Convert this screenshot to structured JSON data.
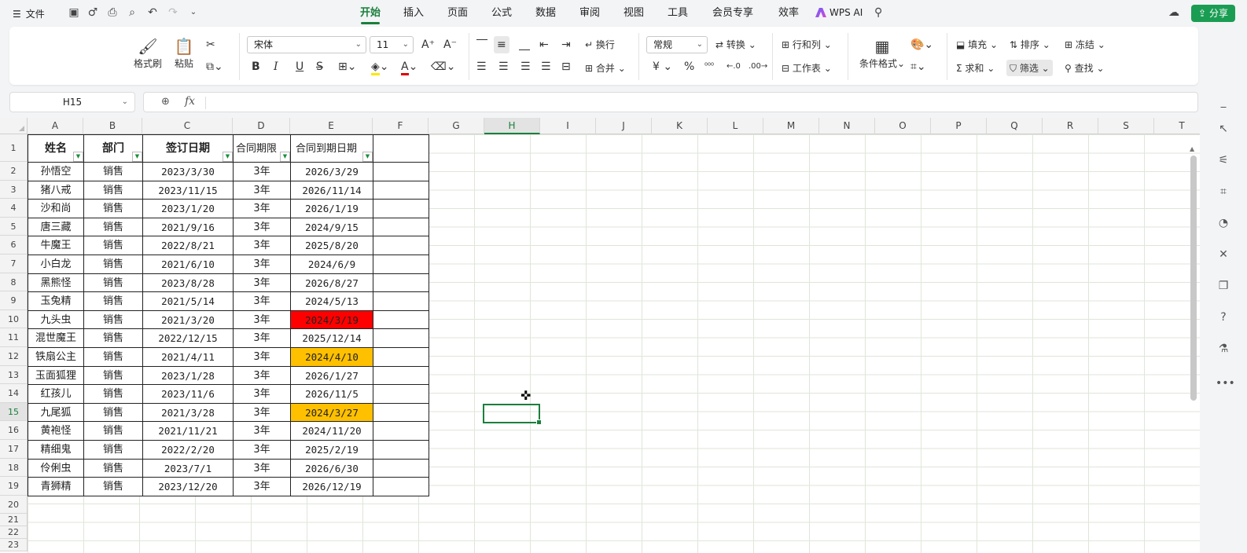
{
  "menubar": {
    "file_label": "文件",
    "tabs": [
      "开始",
      "插入",
      "页面",
      "公式",
      "数据",
      "审阅",
      "视图",
      "工具",
      "会员专享",
      "效率"
    ],
    "active_tab": "开始",
    "wps_ai": "WPS AI",
    "share": "分享"
  },
  "ribbon": {
    "format_painter": "格式刷",
    "paste": "粘贴",
    "font_name": "宋体",
    "font_size": "11",
    "wrap": "换行",
    "merge": "合并",
    "number_format": "常规",
    "convert": "转换",
    "row_col": "行和列",
    "worksheet": "工作表",
    "cond_format": "条件格式",
    "fill": "填充",
    "sort": "排序",
    "freeze": "冻结",
    "sum": "求和",
    "filter": "筛选",
    "find": "查找",
    "bold": "B",
    "italic": "I",
    "underline": "U",
    "currency": "¥",
    "percent": "%"
  },
  "formula_bar": {
    "name_box": "H15",
    "fx": "fx"
  },
  "grid": {
    "columns": [
      "A",
      "B",
      "C",
      "D",
      "E",
      "F",
      "G",
      "H",
      "I",
      "J",
      "K",
      "L",
      "M",
      "N",
      "O",
      "P",
      "Q",
      "R",
      "S",
      "T"
    ],
    "rows": [
      "1",
      "2",
      "3",
      "4",
      "5",
      "6",
      "7",
      "8",
      "9",
      "10",
      "11",
      "12",
      "13",
      "14",
      "15",
      "16",
      "17",
      "18",
      "19",
      "20",
      "21",
      "22",
      "23"
    ],
    "selected_col": "H",
    "selected_row": "15"
  },
  "table": {
    "headers": [
      "姓名",
      "部门",
      "签订日期",
      "合同期限",
      "合同到期日期"
    ],
    "rows": [
      [
        "孙悟空",
        "销售",
        "2023/3/30",
        "3年",
        "2026/3/29",
        ""
      ],
      [
        "猪八戒",
        "销售",
        "2023/11/15",
        "3年",
        "2026/11/14",
        ""
      ],
      [
        "沙和尚",
        "销售",
        "2023/1/20",
        "3年",
        "2026/1/19",
        ""
      ],
      [
        "唐三藏",
        "销售",
        "2021/9/16",
        "3年",
        "2024/9/15",
        ""
      ],
      [
        "牛魔王",
        "销售",
        "2022/8/21",
        "3年",
        "2025/8/20",
        ""
      ],
      [
        "小白龙",
        "销售",
        "2021/6/10",
        "3年",
        "2024/6/9",
        ""
      ],
      [
        "黑熊怪",
        "销售",
        "2023/8/28",
        "3年",
        "2026/8/27",
        ""
      ],
      [
        "玉兔精",
        "销售",
        "2021/5/14",
        "3年",
        "2024/5/13",
        ""
      ],
      [
        "九头虫",
        "销售",
        "2021/3/20",
        "3年",
        "2024/3/19",
        "red"
      ],
      [
        "混世魔王",
        "销售",
        "2022/12/15",
        "3年",
        "2025/12/14",
        ""
      ],
      [
        "铁扇公主",
        "销售",
        "2021/4/11",
        "3年",
        "2024/4/10",
        "orange"
      ],
      [
        "玉面狐狸",
        "销售",
        "2023/1/28",
        "3年",
        "2026/1/27",
        ""
      ],
      [
        "红孩儿",
        "销售",
        "2023/11/6",
        "3年",
        "2026/11/5",
        ""
      ],
      [
        "九尾狐",
        "销售",
        "2021/3/28",
        "3年",
        "2024/3/27",
        "orange"
      ],
      [
        "黄袍怪",
        "销售",
        "2021/11/21",
        "3年",
        "2024/11/20",
        ""
      ],
      [
        "精细鬼",
        "销售",
        "2022/2/20",
        "3年",
        "2025/2/19",
        ""
      ],
      [
        "伶俐虫",
        "销售",
        "2023/7/1",
        "3年",
        "2026/6/30",
        ""
      ],
      [
        "青狮精",
        "销售",
        "2023/12/20",
        "3年",
        "2026/12/19",
        ""
      ]
    ]
  },
  "colors": {
    "accent": "#1a7f3c",
    "highlight_red": "#ff0000",
    "highlight_orange": "#ffc000"
  }
}
